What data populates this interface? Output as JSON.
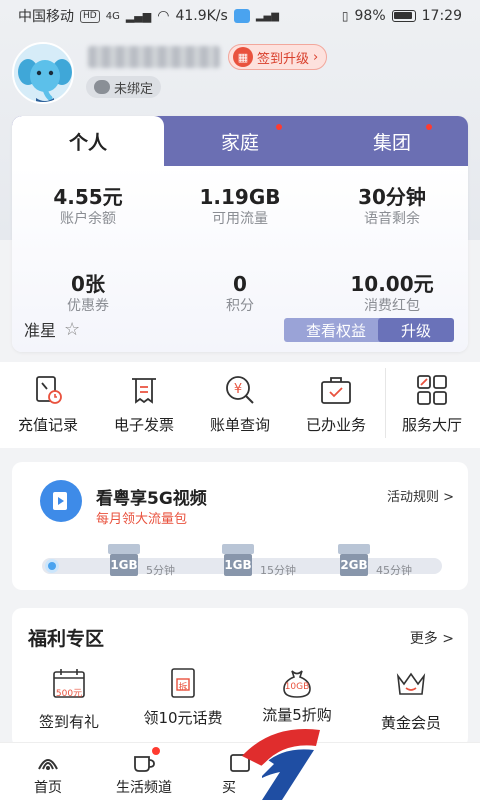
{
  "status_bar": {
    "carrier": "中国移动",
    "network_badge": "HD",
    "signal": "4G",
    "speed": "41.9K/s",
    "battery": "98%",
    "time": "17:29"
  },
  "profile": {
    "signin_label": "签到升级",
    "bind_label": "未绑定"
  },
  "account_tabs": [
    {
      "label": "个人",
      "active": true,
      "dot": false
    },
    {
      "label": "家庭",
      "active": false,
      "dot": true
    },
    {
      "label": "集团",
      "active": false,
      "dot": true
    }
  ],
  "stats": [
    {
      "value": "4.55元",
      "label": "账户余额"
    },
    {
      "value": "1.19GB",
      "label": "可用流量"
    },
    {
      "value": "30分钟",
      "label": "语音剩余"
    },
    {
      "value": "0张",
      "label": "优惠券"
    },
    {
      "value": "0",
      "label": "积分"
    },
    {
      "value": "10.00元",
      "label": "消费红包"
    }
  ],
  "card_footer": {
    "level": "准星",
    "rights_button": "查看权益",
    "upgrade_button": "升级"
  },
  "shortcuts": [
    {
      "label": "充值记录",
      "icon": "recharge-record-icon"
    },
    {
      "label": "电子发票",
      "icon": "invoice-icon"
    },
    {
      "label": "账单查询",
      "icon": "bill-query-icon"
    },
    {
      "label": "已办业务",
      "icon": "handled-business-icon"
    },
    {
      "label": "服务大厅",
      "icon": "service-hall-icon"
    }
  ],
  "promo": {
    "title": "看粤享5G视频",
    "subtitle": "每月领大流量包",
    "rule_link": "活动规则 >",
    "rewards": [
      {
        "badge": "1GB",
        "time": "5分钟"
      },
      {
        "badge": "1GB",
        "time": "15分钟"
      },
      {
        "badge": "2GB",
        "time": "45分钟"
      }
    ]
  },
  "welfare": {
    "title": "福利专区",
    "more": "更多 >",
    "items": [
      {
        "label": "签到有礼",
        "icon_text": "500元"
      },
      {
        "label": "领10元话费",
        "icon_text": "拆"
      },
      {
        "label": "流量5折购",
        "icon_text": "10GB"
      },
      {
        "label": "黄金会员",
        "icon_text": ""
      }
    ]
  },
  "bottom_nav": [
    {
      "label": "首页",
      "icon": "home-logo-icon",
      "dot": false
    },
    {
      "label": "生活频道",
      "icon": "coffee-cup-icon",
      "dot": true
    },
    {
      "label": "买",
      "icon": "shop-icon",
      "dot": false
    }
  ],
  "colors": {
    "tab_bar": "#6b6fb3",
    "accent_red": "#e9523e",
    "upgrade": "#6a72b9"
  }
}
